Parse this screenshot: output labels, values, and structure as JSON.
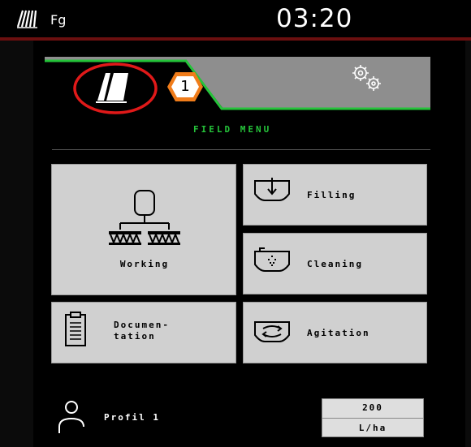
{
  "status_bar": {
    "field_icon": "field-icon",
    "label": "Fg",
    "time": "03:20"
  },
  "tabs": {
    "field_tab_icon": "field-icon",
    "settings_tab_icon": "gears-icon",
    "callout_number": "1",
    "callout_color": "#f07c1a",
    "highlight_color": "#e01919",
    "active_color": "#25c33a"
  },
  "menu": {
    "title": "FIELD MENU",
    "tiles": {
      "working": {
        "label": "Working",
        "icon": "sprayer-icon"
      },
      "filling": {
        "label": "Filling",
        "icon": "tank-fill-icon"
      },
      "cleaning": {
        "label": "Cleaning",
        "icon": "tank-clean-icon"
      },
      "documentation": {
        "label_line1": "Documen-",
        "label_line2": "tation",
        "icon": "clipboard-icon"
      },
      "agitation": {
        "label": "Agitation",
        "icon": "tank-agitate-icon"
      }
    }
  },
  "footer": {
    "profile_icon": "user-icon",
    "profile_label": "Profil 1",
    "rate_value": "200",
    "rate_unit": "L/ha"
  }
}
